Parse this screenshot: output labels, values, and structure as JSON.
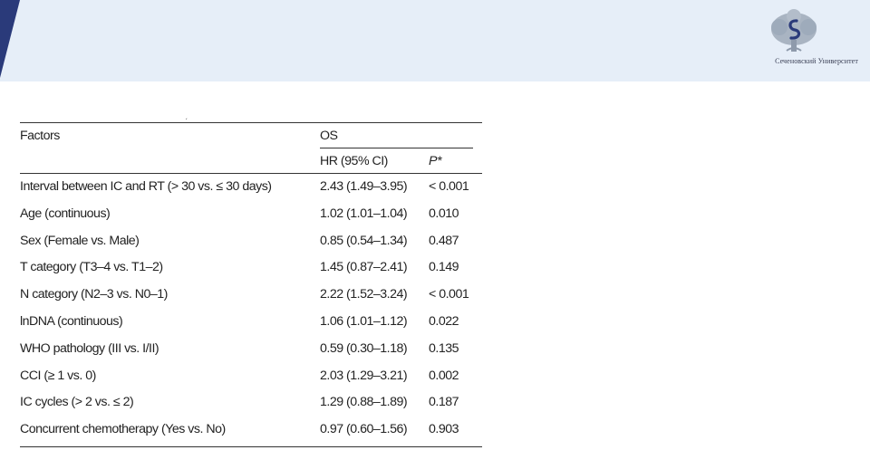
{
  "header": {
    "logo_name": "logo-tree-icon",
    "logo_text": "Сеченовский Университет",
    "accent_color": "#2a3a7a",
    "band_color": "#e6eef8"
  },
  "table": {
    "col_factors": "Factors",
    "col_group": "OS",
    "col_hr": "HR (95% CI)",
    "col_p": "P*",
    "rows": [
      {
        "factor": "Interval between IC and RT (> 30 vs. ≤ 30 days)",
        "hr": "2.43 (1.49–3.95)",
        "p": "< 0.001"
      },
      {
        "factor": "Age (continuous)",
        "hr": "1.02 (1.01–1.04)",
        "p": "0.010"
      },
      {
        "factor": "Sex (Female vs. Male)",
        "hr": "0.85 (0.54–1.34)",
        "p": "0.487"
      },
      {
        "factor": "T category (T3–4 vs. T1–2)",
        "hr": "1.45 (0.87–2.41)",
        "p": "0.149"
      },
      {
        "factor": "N category (N2–3 vs. N0–1)",
        "hr": "2.22 (1.52–3.24)",
        "p": "< 0.001"
      },
      {
        "factor": "lnDNA (continuous)",
        "hr": "1.06 (1.01–1.12)",
        "p": "0.022"
      },
      {
        "factor": "WHO pathology (III vs. I/II)",
        "hr": "0.59 (0.30–1.18)",
        "p": "0.135"
      },
      {
        "factor": "CCI (≥ 1 vs. 0)",
        "hr": "2.03 (1.29–3.21)",
        "p": "0.002"
      },
      {
        "factor": "IC cycles (> 2 vs. ≤ 2)",
        "hr": "1.29 (0.88–1.89)",
        "p": "0.187"
      },
      {
        "factor": "Concurrent chemotherapy (Yes vs. No)",
        "hr": "0.97 (0.60–1.56)",
        "p": "0.903"
      }
    ]
  }
}
